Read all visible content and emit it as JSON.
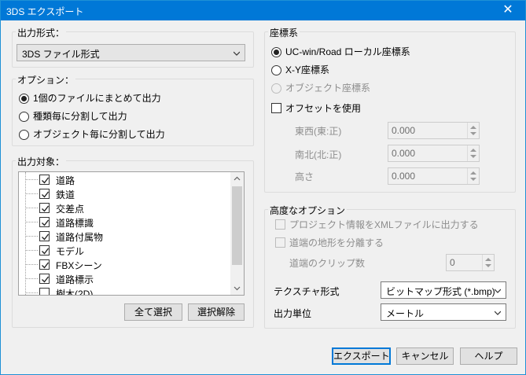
{
  "window": {
    "title": "3DS エクスポート",
    "close_glyph": "✕"
  },
  "output_format": {
    "label": "出力形式：",
    "selected": "3DS ファイル形式"
  },
  "options": {
    "label": "オプション：",
    "items": [
      "1個のファイルにまとめて出力",
      "種類毎に分割して出力",
      "オブジェクト毎に分割して出力"
    ],
    "selected_index": 0
  },
  "targets": {
    "label": "出力対象：",
    "items": [
      {
        "label": "道路",
        "checked": true
      },
      {
        "label": "鉄道",
        "checked": true
      },
      {
        "label": "交差点",
        "checked": true
      },
      {
        "label": "道路標識",
        "checked": true
      },
      {
        "label": "道路付属物",
        "checked": true
      },
      {
        "label": "モデル",
        "checked": true
      },
      {
        "label": "FBXシーン",
        "checked": true
      },
      {
        "label": "道路標示",
        "checked": true
      },
      {
        "label": "樹木(2D)",
        "checked": false
      }
    ],
    "select_all": "全て選択",
    "deselect_all": "選択解除"
  },
  "coordinate": {
    "label": "座標系",
    "items": [
      {
        "label": "UC-win/Road ローカル座標系",
        "selected": true,
        "disabled": false
      },
      {
        "label": "X-Y座標系",
        "selected": false,
        "disabled": false
      },
      {
        "label": "オブジェクト座標系",
        "selected": false,
        "disabled": true
      }
    ],
    "offset": {
      "label": "オフセットを使用",
      "checked": false,
      "east_label": "東西(東:正)",
      "east_value": "0.000",
      "north_label": "南北(北:正)",
      "north_value": "0.000",
      "height_label": "高さ",
      "height_value": "0.000"
    }
  },
  "advanced": {
    "label": "高度なオプション",
    "project_xml": "プロジェクト情報をXMLファイルに出力する",
    "separate_terrain": "道端の地形を分離する",
    "clip_count_label": "道端のクリップ数",
    "clip_count_value": "0",
    "texture_label": "テクスチャ形式",
    "texture_value": "ビットマップ形式 (*.bmp)",
    "unit_label": "出力単位",
    "unit_value": "メートル"
  },
  "footer": {
    "export": "エクスポート",
    "cancel": "キャンセル",
    "help": "ヘルプ"
  },
  "colors": {
    "titlebar": "#0078d7",
    "accent_border": "#0078d7"
  }
}
